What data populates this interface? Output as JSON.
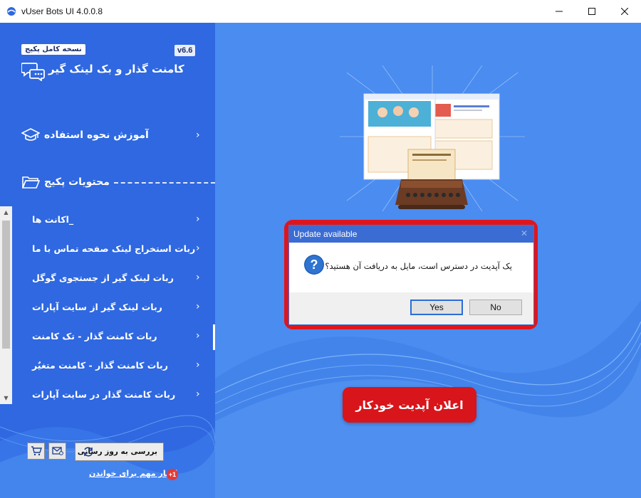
{
  "window": {
    "title": "vUser Bots UI 4.0.0.8"
  },
  "sidebar": {
    "edition": "نسخه کامل پکیج",
    "version": "v6.6",
    "app_name": "کامنت گذار و بک لینک گیر",
    "tutorial": "آموزش نحوه استفاده",
    "package_contents": "محتویات پکیج",
    "items": [
      {
        "label": "_اکانت ها"
      },
      {
        "label": "ربات استخراج لینک صفحه تماس با ما"
      },
      {
        "label": "ربات لینک گیر از جستجوی گوگل"
      },
      {
        "label": "ربات لینک گیر از سایت آپارات"
      },
      {
        "label": "ربات کامنت گذار - تک کامنت"
      },
      {
        "label": "ربات کامنت گذار - کامنت متغیٌر"
      },
      {
        "label": "ربات کامنت گذار در سایت آپارات"
      }
    ],
    "active_index": 4,
    "update_button": "بررسی به روز رسانی",
    "news_link": "اخبار مهم برای خواندن",
    "news_badge": "+1"
  },
  "dialog": {
    "title": "Update available",
    "message": "یک آپدیت در دسترس است، مایل به دریافت آن هستید؟",
    "yes": "Yes",
    "no": "No"
  },
  "banner": "اعلان آپدیت خودکار",
  "colors": {
    "sidebar": "#2f68e0",
    "main": "#4a8cf0",
    "highlight": "#e0151b",
    "dialog_title": "#3a6cd4"
  }
}
